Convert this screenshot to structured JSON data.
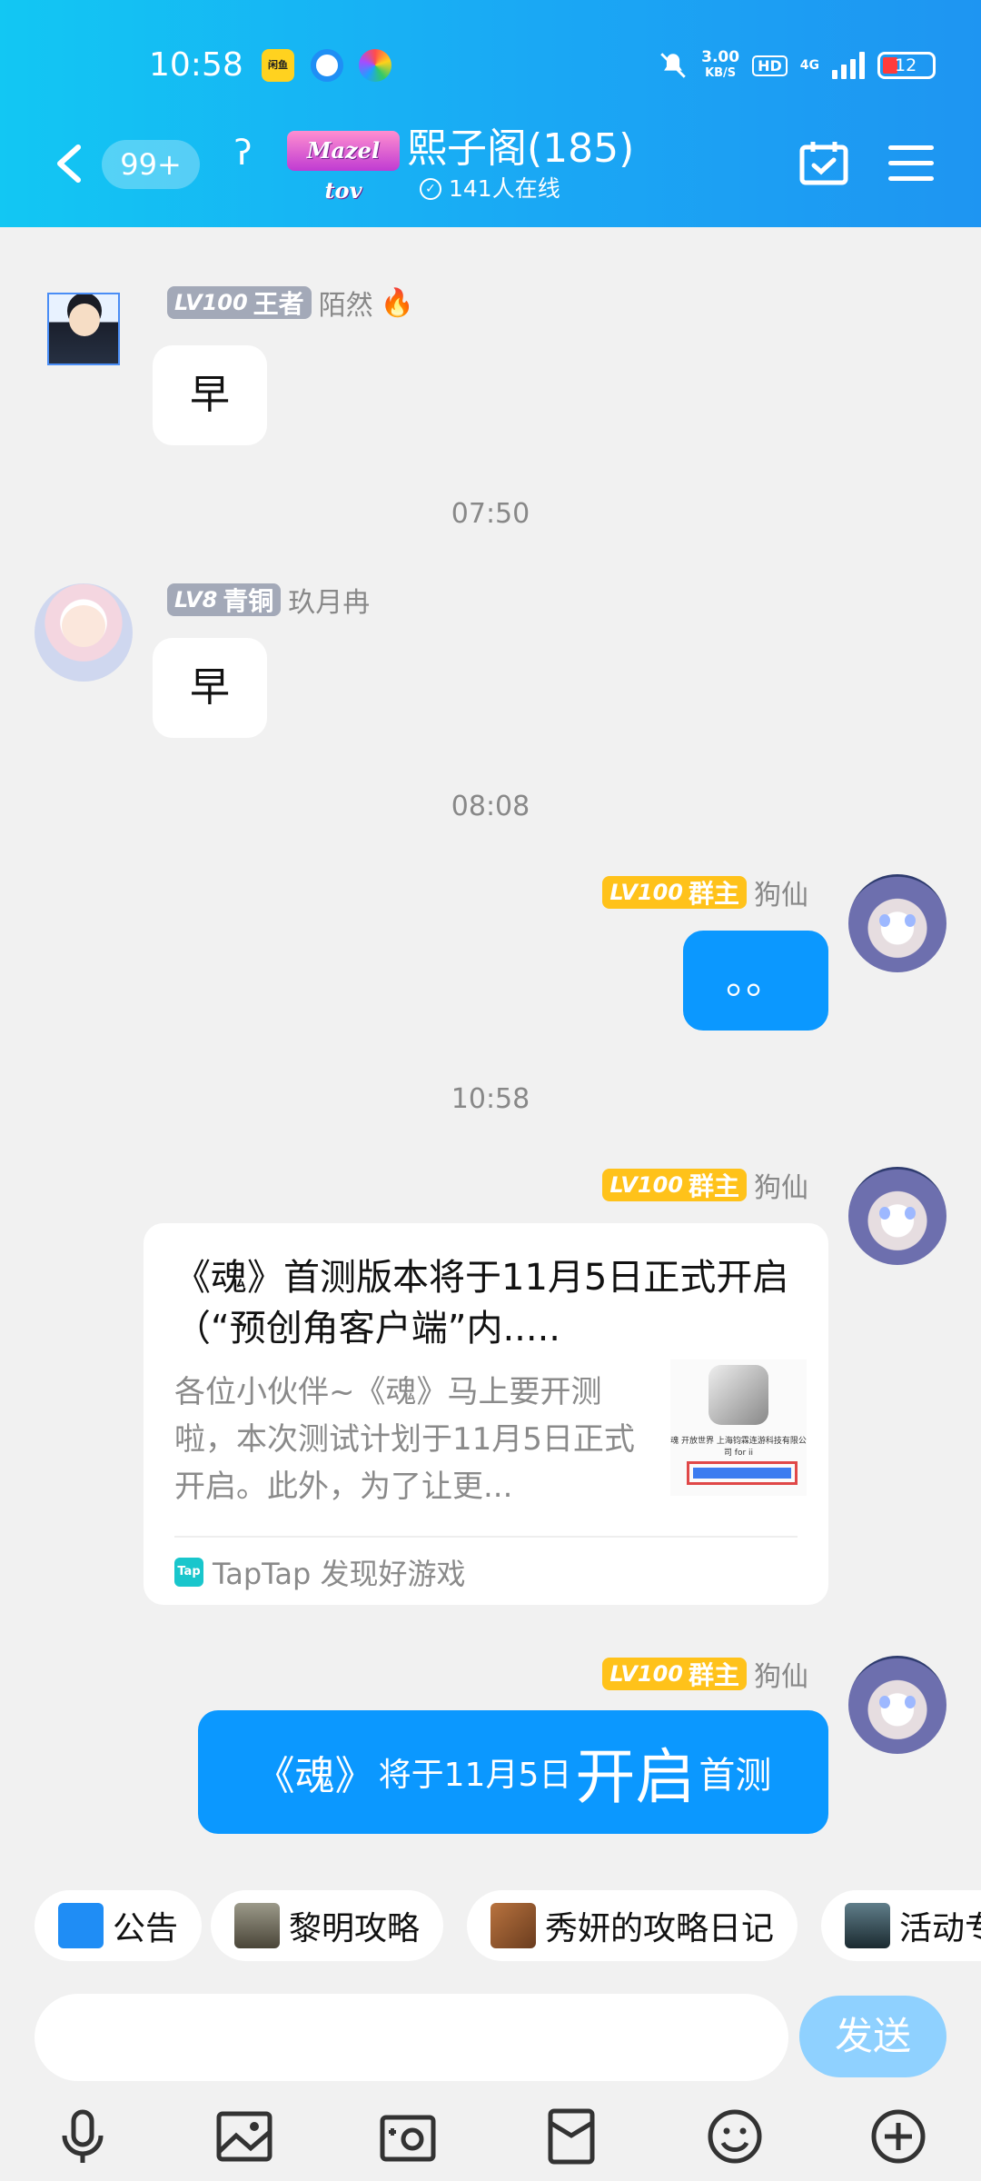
{
  "status": {
    "time": "10:58",
    "netspeed_value": "3.00",
    "netspeed_unit": "KB/S",
    "hd": "HD",
    "network": "4G",
    "battery": "12",
    "app_icon_1": "闲鱼"
  },
  "header": {
    "unread_badge": "99+",
    "mazel_badge": "Mazel tov",
    "group_title": "熙子阁(185)",
    "online_text": "141人在线"
  },
  "messages": [
    {
      "level": "LV100",
      "role": "王者",
      "name": "陌然",
      "text": "早"
    },
    {
      "level": "LV8",
      "role": "青铜",
      "name": "玖月冉",
      "text": "早"
    },
    {
      "level": "LV100",
      "role": "群主",
      "name": "狗仙",
      "text": "。。"
    },
    {
      "level": "LV100",
      "role": "群主",
      "name": "狗仙"
    },
    {
      "level": "LV100",
      "role": "群主",
      "name": "狗仙"
    }
  ],
  "timestamps": [
    "07:50",
    "08:08",
    "10:58"
  ],
  "card": {
    "title": "《魂》首测版本将于11月5日正式开启（“预创角客户端”内.....",
    "description": "各位小伙伴~《魂》马上要开测啦，本次测试计划于11月5日正式开启。此外，为了让更...",
    "thumb_text": "魂 开放世界 上海钧霖连游科技有限公司 for ii",
    "source_icon": "Tap",
    "source": "TapTap 发现好游戏"
  },
  "big_message": {
    "p1": "《魂》",
    "p2": "将于11月5日",
    "p3": "开启",
    "p4": "首测"
  },
  "quick_bar": {
    "items": [
      {
        "label": "公告",
        "icon": "notice-icon"
      },
      {
        "label": "黎明攻略",
        "icon": "dawn-guide-icon"
      },
      {
        "label": "秀妍的攻略日记",
        "icon": "diary-icon"
      },
      {
        "label": "活动专",
        "icon": "activity-icon"
      }
    ]
  },
  "input": {
    "placeholder": "",
    "send_label": "发送"
  },
  "toolbar": {
    "icons": [
      "microphone-icon",
      "image-icon",
      "camera-icon",
      "red-packet-icon",
      "emoji-icon",
      "plus-icon"
    ]
  },
  "colors": {
    "header_start": "#12c7f3",
    "header_end": "#1e95f2",
    "bubble_blue": "#0b98ff",
    "send_button": "#8fd1ff",
    "level_gray": "#a3a9b8",
    "level_gold": "#ffc21a"
  }
}
